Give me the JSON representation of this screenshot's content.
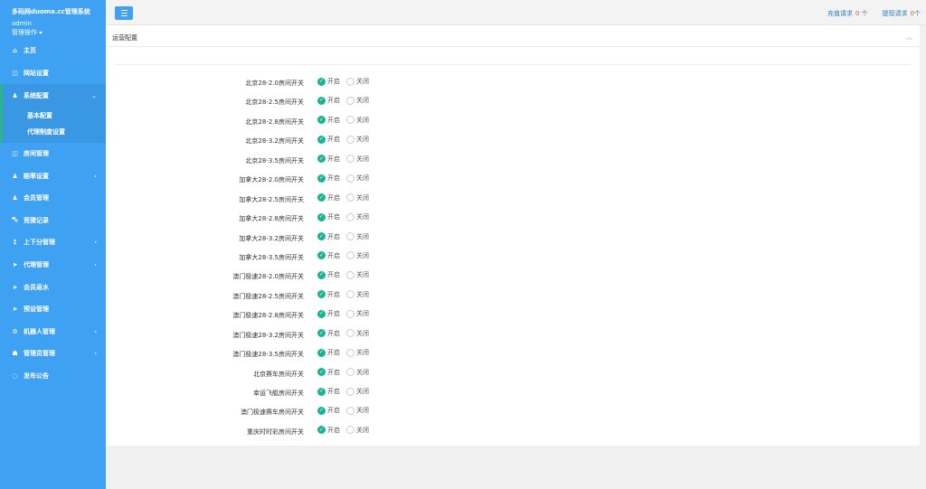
{
  "sidebar": {
    "brand": "多码网duoma.cc管理系统",
    "username": "admin",
    "ops_label": "管理操作",
    "items": [
      {
        "label": "主页",
        "icon": "home-icon",
        "arrow": ""
      },
      {
        "label": "网站设置",
        "icon": "columns-icon",
        "arrow": ""
      },
      {
        "label": "系统配置",
        "icon": "user-icon",
        "arrow": "⌄"
      },
      {
        "label": "房间管理",
        "icon": "columns-icon",
        "arrow": ""
      },
      {
        "label": "赔率设置",
        "icon": "user-icon",
        "arrow": "‹"
      },
      {
        "label": "会员管理",
        "icon": "user-icon",
        "arrow": ""
      },
      {
        "label": "竞猜记录",
        "icon": "car-icon",
        "arrow": ""
      },
      {
        "label": "上下分管理",
        "icon": "level-up-icon",
        "arrow": "‹"
      },
      {
        "label": "代理管理",
        "icon": "send-icon",
        "arrow": "‹"
      },
      {
        "label": "会员返水",
        "icon": "send-icon",
        "arrow": ""
      },
      {
        "label": "预设管理",
        "icon": "send-icon",
        "arrow": ""
      },
      {
        "label": "机器人管理",
        "icon": "robot-icon",
        "arrow": "‹"
      },
      {
        "label": "管理员管理",
        "icon": "android-icon",
        "arrow": "‹"
      },
      {
        "label": "发布公告",
        "icon": "comment-icon",
        "arrow": ""
      }
    ],
    "subitems": [
      "基本配置",
      "代理制度设置"
    ]
  },
  "topbar": {
    "recharge_label": "充值请求",
    "recharge_count": "0",
    "recharge_unit": "个",
    "withdraw_label": "提现请求",
    "withdraw_count": "0",
    "withdraw_unit": "个"
  },
  "panel": {
    "title": "运营配置",
    "on_label": "开启",
    "off_label": "关闭",
    "rows": [
      {
        "label": "北京28-2.0房间开关",
        "value": "on"
      },
      {
        "label": "北京28-2.5房间开关",
        "value": "on"
      },
      {
        "label": "北京28-2.8房间开关",
        "value": "on"
      },
      {
        "label": "北京28-3.2房间开关",
        "value": "on"
      },
      {
        "label": "北京28-3.5房间开关",
        "value": "on"
      },
      {
        "label": "加拿大28-2.0房间开关",
        "value": "on"
      },
      {
        "label": "加拿大28-2.5房间开关",
        "value": "on"
      },
      {
        "label": "加拿大28-2.8房间开关",
        "value": "on"
      },
      {
        "label": "加拿大28-3.2房间开关",
        "value": "on"
      },
      {
        "label": "加拿大28-3.5房间开关",
        "value": "on"
      },
      {
        "label": "澳门极速28-2.0房间开关",
        "value": "on"
      },
      {
        "label": "澳门极速28-2.5房间开关",
        "value": "on"
      },
      {
        "label": "澳门极速28-2.8房间开关",
        "value": "on"
      },
      {
        "label": "澳门极速28-3.2房间开关",
        "value": "on"
      },
      {
        "label": "澳门极速28-3.5房间开关",
        "value": "on"
      },
      {
        "label": "北京赛车房间开关",
        "value": "on"
      },
      {
        "label": "幸运飞艇房间开关",
        "value": "on"
      },
      {
        "label": "澳门极速赛车房间开关",
        "value": "on"
      },
      {
        "label": "重庆时时彩房间开关",
        "value": "on"
      },
      {
        "label": "",
        "value": "on"
      }
    ]
  },
  "colors": {
    "sidebar_bg": "#3ea1f2",
    "active_border": "#2bb58a",
    "radio_on": "#1ab394",
    "link": "#2a7ab8",
    "count": "#d9534f"
  }
}
